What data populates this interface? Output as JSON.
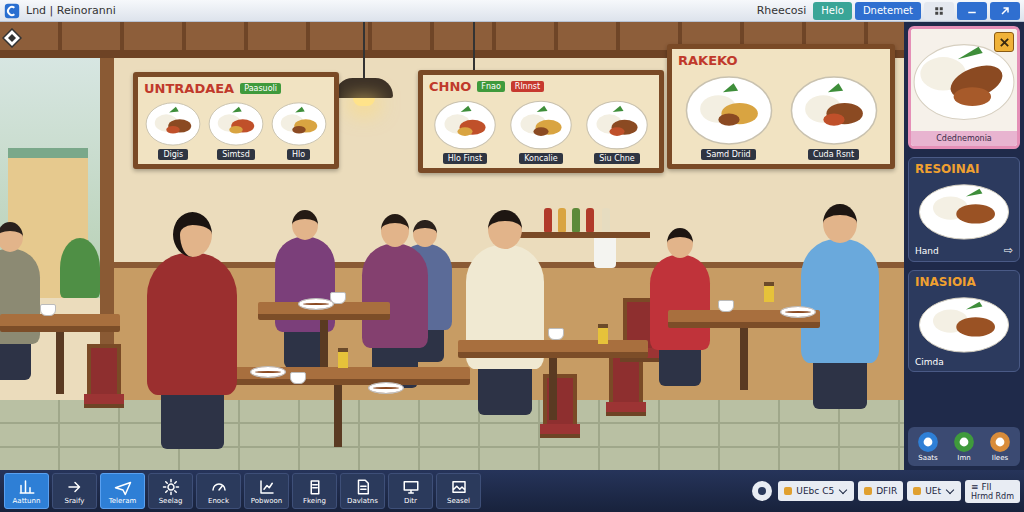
{
  "window": {
    "title": "Lnd | Reinoranni"
  },
  "top_bar": {
    "status": "Rheecosi",
    "buttons": [
      {
        "label": "Helo",
        "kind": "teal"
      },
      {
        "label": "Dnetemet",
        "kind": "blue"
      }
    ]
  },
  "menu_boards": [
    {
      "title": "UNTRADAEA",
      "tags": [
        "Paasuoli"
      ],
      "dishes": [
        "Digis",
        "Simtsd",
        "Hlo"
      ]
    },
    {
      "title": "CHNO",
      "tags": [
        "Fnao",
        "Rlnnst"
      ],
      "dishes": [
        "Hlo Finst",
        "Koncalie",
        "Siu Chne"
      ]
    },
    {
      "title": "RAKEKO",
      "tags": [],
      "dishes": [
        "Samd Driid",
        "Cuda Rsnt"
      ]
    }
  ],
  "side_panel": {
    "featured": {
      "caption": "Cdednemonia"
    },
    "cards": [
      {
        "title": "RESOINAI",
        "caption": "Hand",
        "action": "⇨"
      },
      {
        "title": "INASIOIA",
        "caption": "Cimda"
      }
    ],
    "actions": [
      "Saats",
      "Imn",
      "Ilees"
    ]
  },
  "toolbar": {
    "tools": [
      {
        "label": "Aattunn",
        "selected": true
      },
      {
        "label": "Sraify",
        "selected": false
      },
      {
        "label": "Teleram",
        "selected": true
      },
      {
        "label": "Seelag",
        "selected": false
      },
      {
        "label": "Enock",
        "selected": false
      },
      {
        "label": "Pobwoon",
        "selected": false
      },
      {
        "label": "Fkeing",
        "selected": false
      },
      {
        "label": "Davlatns",
        "selected": false
      },
      {
        "label": "Ditr",
        "selected": false
      },
      {
        "label": "Seasel",
        "selected": false
      }
    ],
    "status": [
      {
        "kind": "dropdown",
        "label": "UEbc C5"
      },
      {
        "kind": "chip",
        "label": "DFIR"
      },
      {
        "kind": "dropdown",
        "label": "UEt"
      },
      {
        "kind": "stack",
        "label": "≡ Fll",
        "sub": "Hrmd Rdm"
      }
    ]
  }
}
